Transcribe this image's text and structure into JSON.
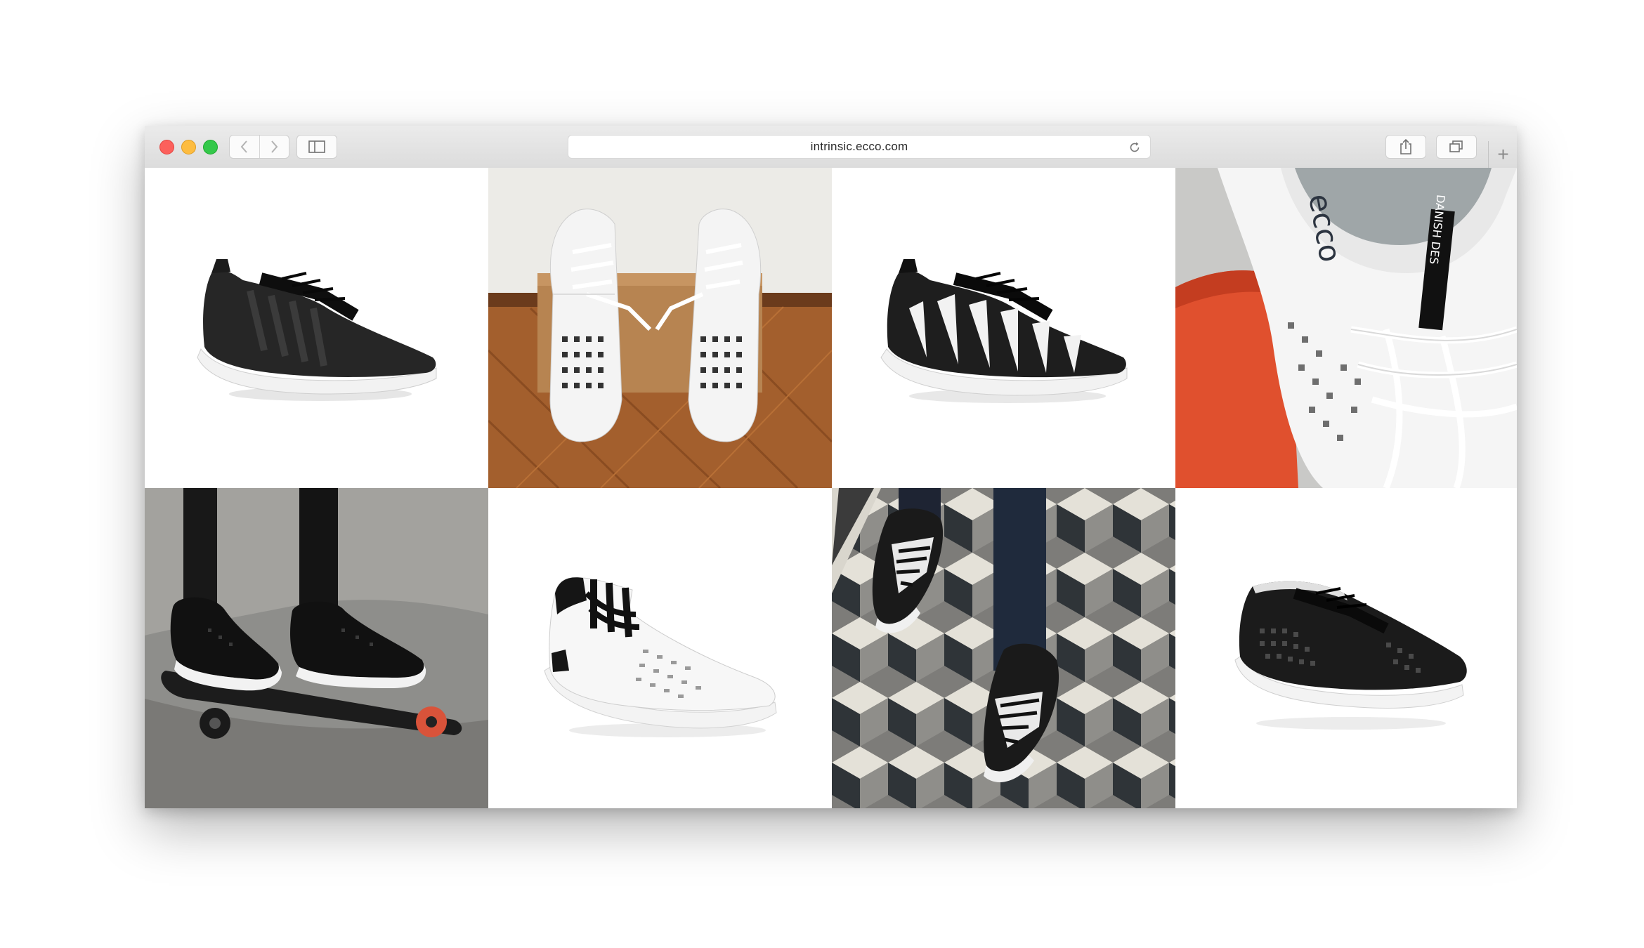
{
  "browser": {
    "url": "intrinsic.ecco.com",
    "new_tab_glyph": "+"
  },
  "icons": {
    "back": "chevron-left-icon",
    "forward": "chevron-right-icon",
    "sidebar": "sidebar-icon",
    "reload": "reload-icon",
    "share": "share-icon",
    "tabs": "tabs-overview-icon"
  },
  "gallery": {
    "tiles": [
      {
        "subject": "black knit sneaker on white"
      },
      {
        "subject": "pair of white perforated sneakers on shoebox"
      },
      {
        "subject": "black and white knit sneaker on white"
      },
      {
        "subject": "white sneaker close-up on orange chair"
      },
      {
        "subject": "black sneakers on skateboard"
      },
      {
        "subject": "white high-top sneaker on white"
      },
      {
        "subject": "knit sneakers on geometric tile floor"
      },
      {
        "subject": "black perforated sneaker on white"
      }
    ],
    "insole_brand_text": "ecco",
    "tongue_label_text": "DANISH DES"
  },
  "colors": {
    "toolbar": "#e2e2e2",
    "close": "#fc605c",
    "minimize": "#fdbc40",
    "maximize": "#34c84a",
    "accent_orange": "#e0502e"
  }
}
